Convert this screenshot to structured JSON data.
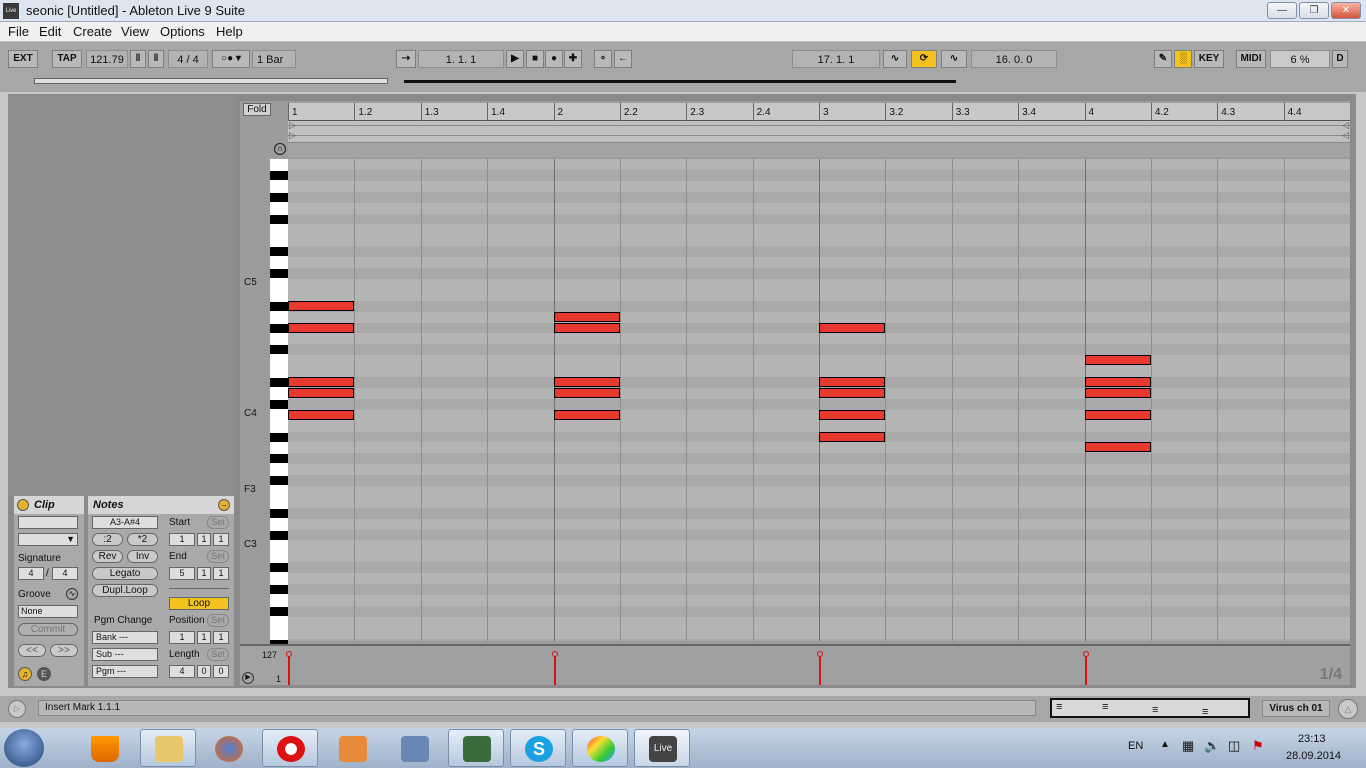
{
  "window": {
    "title": "seonic  [Untitled] - Ableton Live 9 Suite",
    "app_icon": "Live"
  },
  "menu": [
    "File",
    "Edit",
    "Create",
    "View",
    "Options",
    "Help"
  ],
  "control_bar": {
    "ext": "EXT",
    "tap": "TAP",
    "tempo": "121.79",
    "signature": "4  /  4",
    "quantize": "1 Bar",
    "position": "1.   1.   1",
    "loop_start": "17.   1.   1",
    "loop_length": "16.   0.   0",
    "key": "KEY",
    "midi": "MIDI",
    "cpu": "6 %",
    "d": "D"
  },
  "clip": {
    "header": "Clip",
    "signature_label": "Signature",
    "sig_num": "4",
    "sig_den": "4",
    "groove_label": "Groove",
    "groove_value": "None",
    "commit": "Commit",
    "nav_left": "<<",
    "nav_right": ">>"
  },
  "notes": {
    "header": "Notes",
    "range": "A3-A#4",
    "half": ":2",
    "double": "*2",
    "rev": "Rev",
    "inv": "Inv",
    "legato": "Legato",
    "dupl_loop": "Dupl.Loop",
    "pgm_change": "Pgm Change",
    "bank": "Bank ---",
    "sub": "Sub ---",
    "pgm": "Pgm ---",
    "start_label": "Start",
    "end_label": "End",
    "loop": "Loop",
    "position_label": "Position",
    "length_label": "Length",
    "set": "Set",
    "start": [
      "1",
      "1",
      "1"
    ],
    "end": [
      "5",
      "1",
      "1"
    ],
    "position": [
      "1",
      "1",
      "1"
    ],
    "length": [
      "4",
      "0",
      "0"
    ]
  },
  "editor": {
    "fold": "Fold",
    "bar_labels": [
      "1",
      "1.2",
      "1.3",
      "1.4",
      "2",
      "2.2",
      "2.3",
      "2.4",
      "3",
      "3.2",
      "3.3",
      "3.4",
      "4",
      "4.2",
      "4.3",
      "4.4"
    ],
    "note_labels": [
      "C5",
      "C4",
      "F3",
      "C3"
    ],
    "grid_quant": "1/4",
    "vel_max": "127",
    "vel_min": "1"
  },
  "midi_notes": [
    {
      "pitch": "A#4",
      "start": 1.0,
      "length": 0.25
    },
    {
      "pitch": "G#4",
      "start": 1.0,
      "length": 0.25
    },
    {
      "pitch": "D#4",
      "start": 1.0,
      "length": 0.25
    },
    {
      "pitch": "D4",
      "start": 1.0,
      "length": 0.25
    },
    {
      "pitch": "C4",
      "start": 1.0,
      "length": 0.25
    },
    {
      "pitch": "A4",
      "start": 2.0,
      "length": 0.25
    },
    {
      "pitch": "G#4",
      "start": 2.0,
      "length": 0.25
    },
    {
      "pitch": "D#4",
      "start": 2.0,
      "length": 0.25
    },
    {
      "pitch": "D4",
      "start": 2.0,
      "length": 0.25
    },
    {
      "pitch": "C4",
      "start": 2.0,
      "length": 0.25
    },
    {
      "pitch": "G#4",
      "start": 3.0,
      "length": 0.25
    },
    {
      "pitch": "D#4",
      "start": 3.0,
      "length": 0.25
    },
    {
      "pitch": "D4",
      "start": 3.0,
      "length": 0.25
    },
    {
      "pitch": "C4",
      "start": 3.0,
      "length": 0.25
    },
    {
      "pitch": "A#3",
      "start": 3.0,
      "length": 0.25
    },
    {
      "pitch": "F4",
      "start": 4.0,
      "length": 0.25
    },
    {
      "pitch": "D#4",
      "start": 4.0,
      "length": 0.25
    },
    {
      "pitch": "D4",
      "start": 4.0,
      "length": 0.25
    },
    {
      "pitch": "C4",
      "start": 4.0,
      "length": 0.25
    },
    {
      "pitch": "A3",
      "start": 4.0,
      "length": 0.25
    }
  ],
  "status": {
    "text": "Insert Mark 1.1.1",
    "device": "Virus ch 01"
  },
  "taskbar": {
    "lang": "EN",
    "time": "23:13",
    "date": "28.09.2014",
    "live_label": "Live"
  }
}
